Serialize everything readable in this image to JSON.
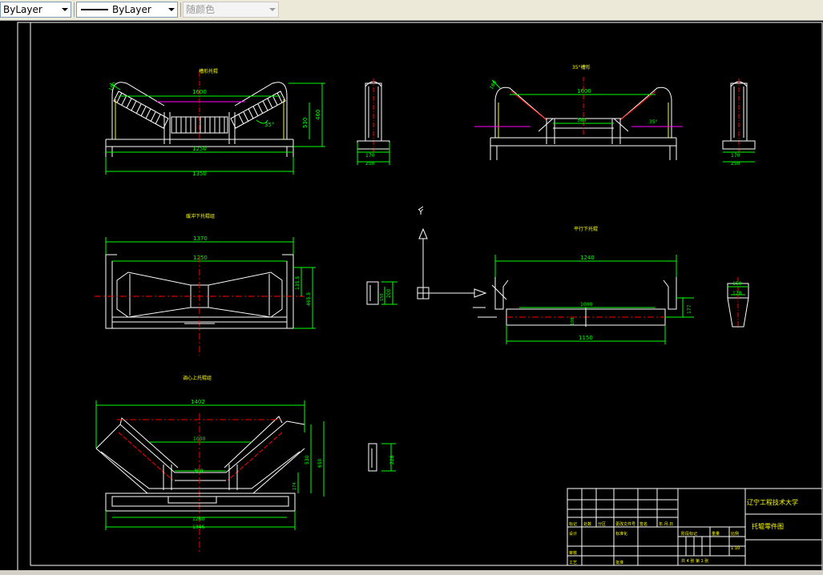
{
  "toolbar": {
    "color_dropdown": "ByLayer",
    "linetype_dropdown": "ByLayer",
    "plot_style_dropdown": "随颜色"
  },
  "drawing": {
    "background": "#000000",
    "colors": {
      "outline": "#ffffff",
      "dimension": "#00ff00",
      "center": "#ff0000",
      "hidden": "#ff00ff",
      "text": "#ffff00"
    },
    "views": {
      "top_left": {
        "title": "槽形托辊",
        "dims": [
          "1600",
          "1250",
          "1350",
          "530",
          "460",
          "35°",
          "180"
        ]
      },
      "top_right": {
        "title": "35°槽形",
        "dims": [
          "1600",
          "380",
          "180",
          "35°"
        ]
      },
      "side_top_left": {
        "dims": [
          "170",
          "250"
        ]
      },
      "side_top_right": {
        "dims": [
          "170",
          "250"
        ]
      },
      "mid_left": {
        "title": "缓冲下托辊组",
        "dims": [
          "1370",
          "1250",
          "135.5",
          "465.5"
        ]
      },
      "mid_small": {
        "dims": [
          "200",
          "150"
        ]
      },
      "axis": {
        "y_label": "Y"
      },
      "mid_right": {
        "title": "平行下托辊",
        "dims": [
          "1240",
          "1000",
          "1150",
          "177",
          "108"
        ]
      },
      "mid_side_right": {
        "dims": [
          "150",
          "170"
        ]
      },
      "bottom_left": {
        "title": "调心上托辊组",
        "dims": [
          "1402",
          "1000",
          "380",
          "1260",
          "1346",
          "530",
          "650",
          "174"
        ]
      },
      "bottom_small": {
        "dims": [
          "228"
        ]
      }
    },
    "title_block": {
      "school": "辽宁工程技术大学",
      "drawing_name": "托辊零件图",
      "headers": [
        "标记",
        "处数",
        "分区",
        "更改文件号",
        "签名",
        "年.月.日"
      ],
      "rows": [
        "设计",
        "审核",
        "工艺",
        "标准化",
        "批准"
      ],
      "stage_label": "阶段标记",
      "weight_label": "重量",
      "scale_label": "比例",
      "scale": "1:10",
      "sheet_info": "共 4 张   第 1 张"
    }
  }
}
